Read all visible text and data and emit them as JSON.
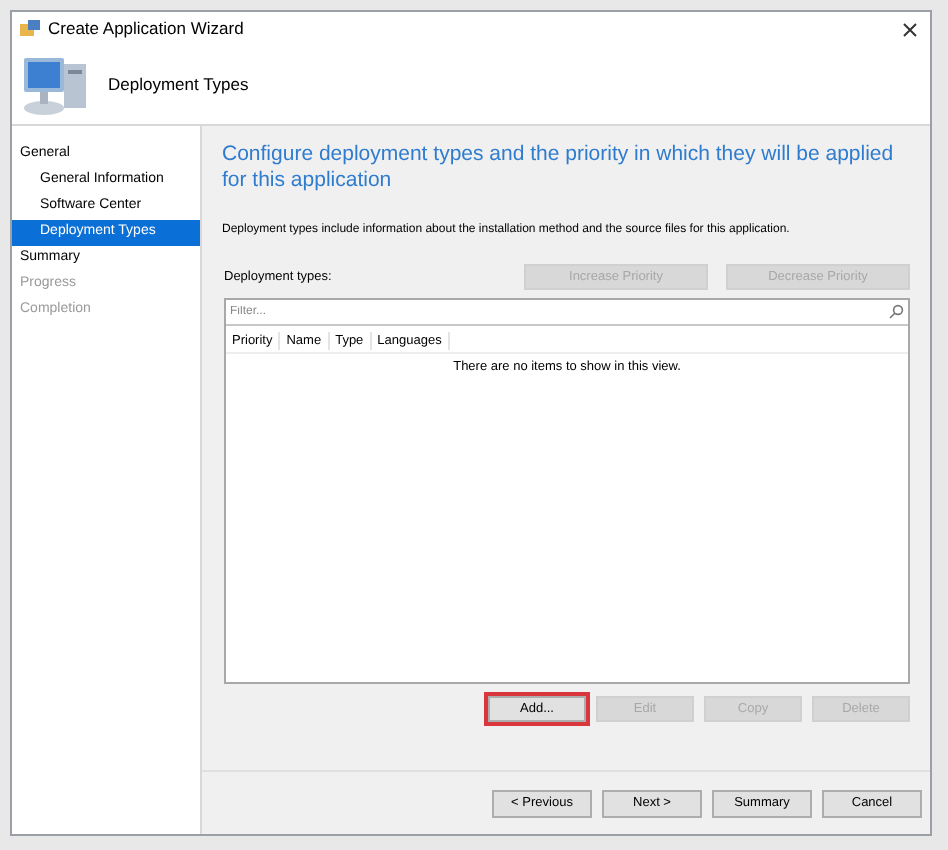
{
  "window": {
    "title": "Create Application Wizard"
  },
  "header": {
    "title": "Deployment Types"
  },
  "sidebar": {
    "items": [
      {
        "label": "General",
        "selected": false,
        "disabled": false,
        "children": [
          {
            "label": "General Information",
            "selected": false,
            "disabled": false
          },
          {
            "label": "Software Center",
            "selected": false,
            "disabled": false
          },
          {
            "label": "Deployment Types",
            "selected": true,
            "disabled": false
          }
        ]
      },
      {
        "label": "Summary",
        "selected": false,
        "disabled": false
      },
      {
        "label": "Progress",
        "selected": false,
        "disabled": true
      },
      {
        "label": "Completion",
        "selected": false,
        "disabled": true
      }
    ]
  },
  "content": {
    "heading": "Configure deployment types and the priority in which they will be applied for this application",
    "description": "Deployment types include information about the installation method and the source files for this application.",
    "list_label": "Deployment types:",
    "priority_buttons": [
      {
        "label": "Increase Priority",
        "disabled": true
      },
      {
        "label": "Decrease Priority",
        "disabled": true
      }
    ],
    "filter": {
      "placeholder": "Filter..."
    },
    "columns": [
      "Priority",
      "Name",
      "Type",
      "Languages"
    ],
    "empty_message": "There are no items to show in this view.",
    "action_buttons": [
      {
        "label": "Add...",
        "disabled": false,
        "highlighted": true
      },
      {
        "label": "Edit",
        "disabled": true,
        "highlighted": false
      },
      {
        "label": "Copy",
        "disabled": true,
        "highlighted": false
      },
      {
        "label": "Delete",
        "disabled": true,
        "highlighted": false
      }
    ]
  },
  "footer_buttons": [
    {
      "label": "< Previous"
    },
    {
      "label": "Next >"
    },
    {
      "label": "Summary"
    },
    {
      "label": "Cancel"
    }
  ]
}
